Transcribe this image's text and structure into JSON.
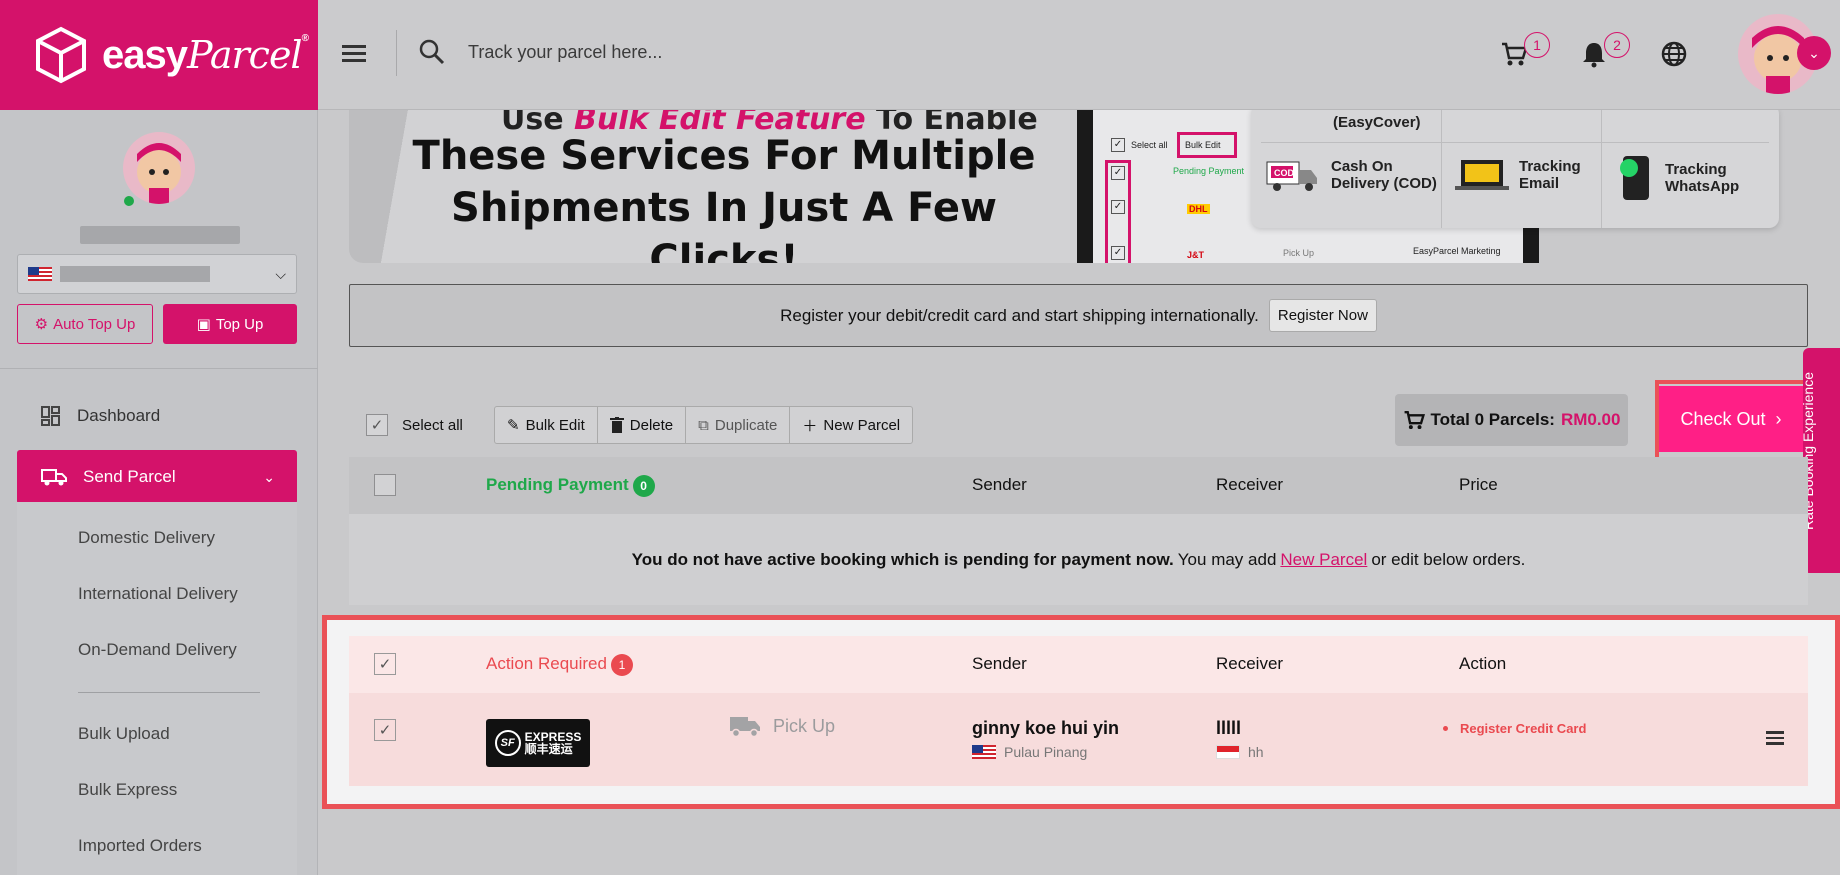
{
  "brand": {
    "logo_text": "easy",
    "logo_script": "Parcel",
    "registered": "®",
    "accent": "#d4126a"
  },
  "header": {
    "search_placeholder": "Track your parcel here...",
    "cart_count": "1",
    "notification_count": "2"
  },
  "sidebar": {
    "auto_topup_label": "Auto Top Up",
    "topup_label": "Top Up",
    "nav": [
      {
        "label": "Dashboard"
      },
      {
        "label": "Send Parcel"
      }
    ],
    "sub_items": [
      {
        "label": "Domestic Delivery"
      },
      {
        "label": "International Delivery"
      },
      {
        "label": "On-Demand Delivery"
      },
      {
        "label": "Bulk Upload"
      },
      {
        "label": "Bulk Express"
      },
      {
        "label": "Imported Orders"
      }
    ]
  },
  "banner": {
    "subtitle_prefix": "Use ",
    "subtitle_em": "Bulk Edit Feature",
    "subtitle_suffix": " To Enable",
    "title_line1": "These Services For Multiple",
    "title_line2": "Shipments In Just A Few Clicks!",
    "mock": {
      "select_all": "Select all",
      "bulk_edit": "Bulk Edit",
      "pending_payment": "Pending Payment",
      "dhl": "DHL",
      "jt": "J&T",
      "pick_up": "Pick Up",
      "marketing": "EasyParcel Marketing"
    },
    "services": [
      {
        "label": "(EasyCover)"
      },
      {
        "label": "Cash On Delivery (COD)",
        "line1": "Cash On",
        "line2": "Delivery (COD)",
        "icon_text": "COD"
      },
      {
        "label": "Tracking Email",
        "line1": "Tracking",
        "line2": "Email"
      },
      {
        "label": "Tracking WhatsApp",
        "line1": "Tracking",
        "line2": "WhatsApp"
      }
    ]
  },
  "notice": {
    "text": "Register your debit/credit card and start shipping internationally.",
    "button_label": "Register Now"
  },
  "toolbar": {
    "select_all_label": "Select all",
    "bulk_edit_label": "Bulk Edit",
    "delete_label": "Delete",
    "duplicate_label": "Duplicate",
    "new_parcel_label": "New Parcel",
    "total_label": "Total 0 Parcels:",
    "total_amount": "RM0.00",
    "checkout_label": "Check Out"
  },
  "rate_tab_label": "Rate Booking Experience",
  "pending_table": {
    "title": "Pending Payment",
    "count": "0",
    "count_color": "#1fa84a",
    "columns": [
      "Sender",
      "Receiver",
      "Price"
    ],
    "empty_bold": "You do not have active booking which is pending for payment now.",
    "empty_rest_1": "You may add",
    "empty_link": "New Parcel",
    "empty_rest_2": "or edit below orders."
  },
  "action_table": {
    "title": "Action Required",
    "count": "1",
    "count_color": "#ea4a50",
    "columns": [
      "Sender",
      "Receiver",
      "Action"
    ],
    "rows": [
      {
        "courier": "SF EXPRESS",
        "courier_badge": "SF",
        "courier_line1": "EXPRESS",
        "courier_line2": "顺丰速运",
        "service": "Pick Up",
        "sender_name": "ginny koe hui yin",
        "sender_location": "Pulau Pinang",
        "receiver_name": "lllll",
        "receiver_location": "hh",
        "action": "Register Credit Card"
      }
    ]
  }
}
